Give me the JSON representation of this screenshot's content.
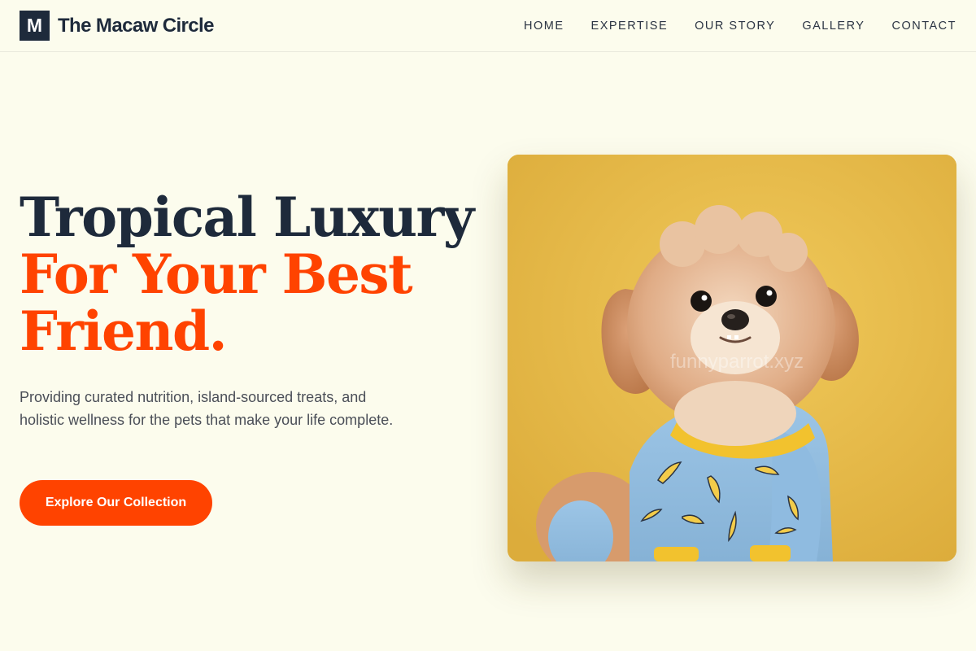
{
  "brand": {
    "mark": "M",
    "name": "The Macaw Circle"
  },
  "nav": {
    "items": [
      {
        "label": "HOME"
      },
      {
        "label": "EXPERTISE"
      },
      {
        "label": "OUR STORY"
      },
      {
        "label": "GALLERY"
      },
      {
        "label": "CONTACT"
      }
    ]
  },
  "hero": {
    "title_line_1": "Tropical Luxury",
    "title_line_2": "For Your Best",
    "title_line_3": "Friend.",
    "description": "Providing curated nutrition, island-sourced treats, and holistic wellness for the pets that make your life complete.",
    "cta_label": "Explore Our Collection",
    "image_watermark": "funnyparrot.xyz"
  },
  "colors": {
    "background": "#fcfced",
    "navy": "#1e2a3b",
    "accent": "#ff4300",
    "image_backdrop": "#e8bd4d"
  }
}
